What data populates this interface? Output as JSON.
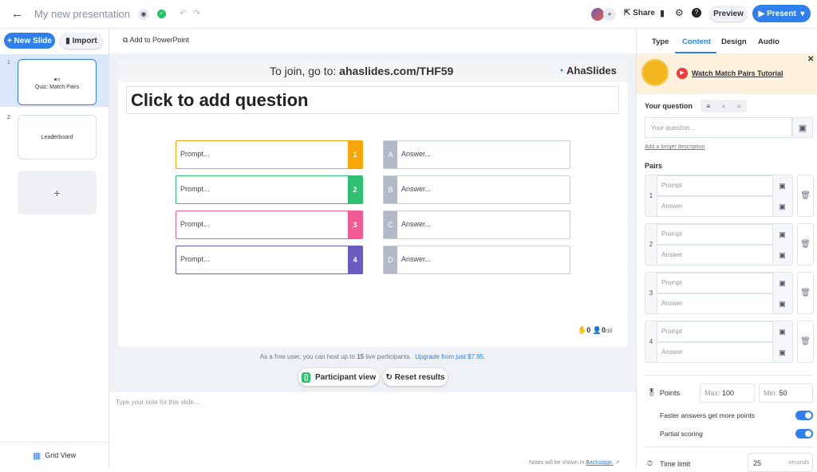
{
  "header": {
    "title": "My new presentation",
    "share": "Share",
    "preview": "Preview",
    "present": "Present"
  },
  "left": {
    "new_slide": "+ New Slide",
    "import": "Import",
    "slides": [
      {
        "num": "1",
        "label": "Quiz: Match Pairs"
      },
      {
        "num": "2",
        "label": "Leaderboard"
      }
    ],
    "add": "+",
    "grid_view": "Grid View"
  },
  "toolbar": {
    "add_ppt": "Add to PowerPoint"
  },
  "slide": {
    "join_prefix": "To join, go to: ",
    "join_url": "ahaslides.com/THF59",
    "brand": "AhaSlides",
    "question": "Click to add question",
    "prompts": [
      {
        "text": "Prompt...",
        "num": "1",
        "color": "#f6a609"
      },
      {
        "text": "Prompt...",
        "num": "2",
        "color": "#2fbf71"
      },
      {
        "text": "Prompt...",
        "num": "3",
        "color": "#f25c95"
      },
      {
        "text": "Prompt...",
        "num": "4",
        "color": "#6a5bbf"
      }
    ],
    "answers": [
      {
        "letter": "A",
        "text": "Answer..."
      },
      {
        "letter": "B",
        "text": "Answer..."
      },
      {
        "letter": "C",
        "text": "Answer..."
      },
      {
        "letter": "D",
        "text": "Answer..."
      }
    ],
    "reactions": "0",
    "participants": "0",
    "participants_max": "/15"
  },
  "footer": {
    "free_msg_a": "As a free user, you can host up to ",
    "free_num": "15",
    "free_msg_b": " live participants.",
    "upgrade": "Upgrade from just $7.95.",
    "participant_view": "Participant view",
    "reset": "Reset results",
    "note_placeholder": "Type your note for this slide...",
    "notes_msg": "Notes will be shown in ",
    "backstage": "Backstage."
  },
  "panel": {
    "tabs": [
      "Type",
      "Content",
      "Design",
      "Audio"
    ],
    "active_tab": "Content",
    "tutorial": "Watch Match Pairs Tutorial",
    "your_question": "Your question",
    "question_placeholder": "Your question...",
    "longer_desc": "Add a longer description",
    "pairs_label": "Pairs",
    "pairs": [
      {
        "num": "1",
        "prompt": "Prompt",
        "answer": "Answer"
      },
      {
        "num": "2",
        "prompt": "Prompt",
        "answer": "Answer"
      },
      {
        "num": "3",
        "prompt": "Prompt",
        "answer": "Answer"
      },
      {
        "num": "4",
        "prompt": "Prompt",
        "answer": "Answer"
      }
    ],
    "points": "Points",
    "max_label": "Max:",
    "max": "100",
    "min_label": "Min:",
    "min": "50",
    "faster": "Faster answers get more points",
    "faster_on": true,
    "partial": "Partial scoring",
    "partial_on": true,
    "time_limit": "Time limit",
    "time_value": "25",
    "seconds": "seconds"
  },
  "colors": {
    "accent": "#2f80ed",
    "selected_slide_bg": "#dbe8fb"
  }
}
